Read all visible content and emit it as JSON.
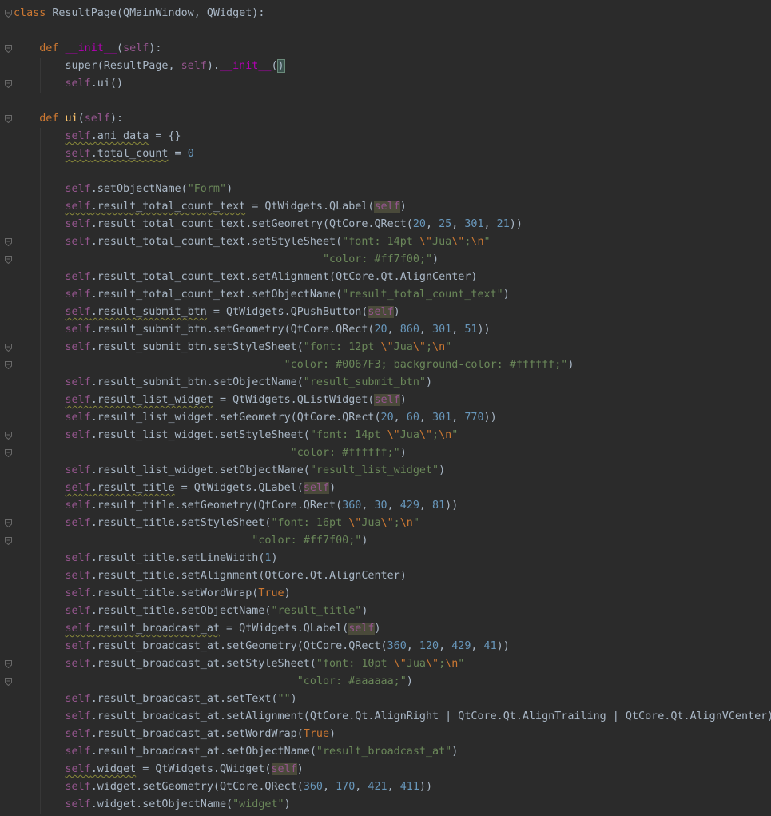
{
  "editor": {
    "language": "python",
    "colors": {
      "background": "#2b2b2b",
      "default_text": "#a9b7c6",
      "keyword": "#cc7832",
      "function_name": "#ffc66d",
      "self": "#94558d",
      "string": "#6a8759",
      "number": "#6897bb",
      "magic_method": "#b200b2"
    },
    "lines": [
      [
        {
          "t": "class",
          "c": "kw"
        },
        {
          "t": " ResultPage(QMainWindow, QWidget):"
        }
      ],
      [],
      [
        {
          "t": "    "
        },
        {
          "t": "def",
          "c": "kw"
        },
        {
          "t": " "
        },
        {
          "t": "__init__",
          "c": "magic"
        },
        {
          "t": "("
        },
        {
          "t": "self",
          "c": "self"
        },
        {
          "t": "):"
        }
      ],
      [
        {
          "t": "        super(ResultPage, "
        },
        {
          "t": "self",
          "c": "self"
        },
        {
          "t": ")."
        },
        {
          "t": "__init__",
          "c": "magic"
        },
        {
          "t": "("
        },
        {
          "t": ")",
          "c": "brk"
        }
      ],
      [
        {
          "t": "        "
        },
        {
          "t": "self",
          "c": "self"
        },
        {
          "t": ".ui()"
        }
      ],
      [],
      [
        {
          "t": "    "
        },
        {
          "t": "def",
          "c": "kw"
        },
        {
          "t": " "
        },
        {
          "t": "ui",
          "c": "fn"
        },
        {
          "t": "("
        },
        {
          "t": "self",
          "c": "self"
        },
        {
          "t": "):"
        }
      ],
      [
        {
          "t": "        "
        },
        {
          "t": "self",
          "c": "self warn"
        },
        {
          "t": ".ani_data",
          "c": "warn"
        },
        {
          "t": " = {}"
        }
      ],
      [
        {
          "t": "        "
        },
        {
          "t": "self",
          "c": "self warn"
        },
        {
          "t": ".total_count",
          "c": "warn"
        },
        {
          "t": " = "
        },
        {
          "t": "0",
          "c": "num"
        }
      ],
      [],
      [
        {
          "t": "        "
        },
        {
          "t": "self",
          "c": "self"
        },
        {
          "t": ".setObjectName("
        },
        {
          "t": "\"Form\"",
          "c": "str"
        },
        {
          "t": ")"
        }
      ],
      [
        {
          "t": "        "
        },
        {
          "t": "self",
          "c": "self warn"
        },
        {
          "t": ".result_total_count_text",
          "c": "warn"
        },
        {
          "t": " = QtWidgets.QLabel("
        },
        {
          "t": "self",
          "c": "self hl"
        },
        {
          "t": ")"
        }
      ],
      [
        {
          "t": "        "
        },
        {
          "t": "self",
          "c": "self"
        },
        {
          "t": ".result_total_count_text.setGeometry(QtCore.QRect("
        },
        {
          "t": "20",
          "c": "num"
        },
        {
          "t": ", "
        },
        {
          "t": "25",
          "c": "num"
        },
        {
          "t": ", "
        },
        {
          "t": "301",
          "c": "num"
        },
        {
          "t": ", "
        },
        {
          "t": "21",
          "c": "num"
        },
        {
          "t": "))"
        }
      ],
      [
        {
          "t": "        "
        },
        {
          "t": "self",
          "c": "self"
        },
        {
          "t": ".result_total_count_text.setStyleSheet("
        },
        {
          "t": "\"font: 14pt ",
          "c": "str"
        },
        {
          "t": "\\\"",
          "c": "esc"
        },
        {
          "t": "Jua",
          "c": "str"
        },
        {
          "t": "\\\"",
          "c": "esc"
        },
        {
          "t": ";",
          "c": "str"
        },
        {
          "t": "\\n",
          "c": "esc"
        },
        {
          "t": "\"",
          "c": "str"
        }
      ],
      [
        {
          "t": "                                                "
        },
        {
          "t": "\"color: #ff7f00;\"",
          "c": "str"
        },
        {
          "t": ")"
        }
      ],
      [
        {
          "t": "        "
        },
        {
          "t": "self",
          "c": "self"
        },
        {
          "t": ".result_total_count_text.setAlignment(QtCore.Qt.AlignCenter)"
        }
      ],
      [
        {
          "t": "        "
        },
        {
          "t": "self",
          "c": "self"
        },
        {
          "t": ".result_total_count_text.setObjectName("
        },
        {
          "t": "\"result_total_count_text\"",
          "c": "str"
        },
        {
          "t": ")"
        }
      ],
      [
        {
          "t": "        "
        },
        {
          "t": "self",
          "c": "self warn"
        },
        {
          "t": ".result_submit_btn",
          "c": "warn"
        },
        {
          "t": " = QtWidgets.QPushButton("
        },
        {
          "t": "self",
          "c": "self hl"
        },
        {
          "t": ")"
        }
      ],
      [
        {
          "t": "        "
        },
        {
          "t": "self",
          "c": "self"
        },
        {
          "t": ".result_submit_btn.setGeometry(QtCore.QRect("
        },
        {
          "t": "20",
          "c": "num"
        },
        {
          "t": ", "
        },
        {
          "t": "860",
          "c": "num"
        },
        {
          "t": ", "
        },
        {
          "t": "301",
          "c": "num"
        },
        {
          "t": ", "
        },
        {
          "t": "51",
          "c": "num"
        },
        {
          "t": "))"
        }
      ],
      [
        {
          "t": "        "
        },
        {
          "t": "self",
          "c": "self"
        },
        {
          "t": ".result_submit_btn.setStyleSheet("
        },
        {
          "t": "\"font: 12pt ",
          "c": "str"
        },
        {
          "t": "\\\"",
          "c": "esc"
        },
        {
          "t": "Jua",
          "c": "str"
        },
        {
          "t": "\\\"",
          "c": "esc"
        },
        {
          "t": ";",
          "c": "str"
        },
        {
          "t": "\\n",
          "c": "esc"
        },
        {
          "t": "\"",
          "c": "str"
        }
      ],
      [
        {
          "t": "                                          "
        },
        {
          "t": "\"color: #0067F3; background-color: #ffffff;\"",
          "c": "str"
        },
        {
          "t": ")"
        }
      ],
      [
        {
          "t": "        "
        },
        {
          "t": "self",
          "c": "self"
        },
        {
          "t": ".result_submit_btn.setObjectName("
        },
        {
          "t": "\"result_submit_btn\"",
          "c": "str"
        },
        {
          "t": ")"
        }
      ],
      [
        {
          "t": "        "
        },
        {
          "t": "self",
          "c": "self warn"
        },
        {
          "t": ".result_list_widget",
          "c": "warn"
        },
        {
          "t": " = QtWidgets.QListWidget("
        },
        {
          "t": "self",
          "c": "self hl"
        },
        {
          "t": ")"
        }
      ],
      [
        {
          "t": "        "
        },
        {
          "t": "self",
          "c": "self"
        },
        {
          "t": ".result_list_widget.setGeometry(QtCore.QRect("
        },
        {
          "t": "20",
          "c": "num"
        },
        {
          "t": ", "
        },
        {
          "t": "60",
          "c": "num"
        },
        {
          "t": ", "
        },
        {
          "t": "301",
          "c": "num"
        },
        {
          "t": ", "
        },
        {
          "t": "770",
          "c": "num"
        },
        {
          "t": "))"
        }
      ],
      [
        {
          "t": "        "
        },
        {
          "t": "self",
          "c": "self"
        },
        {
          "t": ".result_list_widget.setStyleSheet("
        },
        {
          "t": "\"font: 14pt ",
          "c": "str"
        },
        {
          "t": "\\\"",
          "c": "esc"
        },
        {
          "t": "Jua",
          "c": "str"
        },
        {
          "t": "\\\"",
          "c": "esc"
        },
        {
          "t": ";",
          "c": "str"
        },
        {
          "t": "\\n",
          "c": "esc"
        },
        {
          "t": "\"",
          "c": "str"
        }
      ],
      [
        {
          "t": "                                           "
        },
        {
          "t": "\"color: #ffffff;\"",
          "c": "str"
        },
        {
          "t": ")"
        }
      ],
      [
        {
          "t": "        "
        },
        {
          "t": "self",
          "c": "self"
        },
        {
          "t": ".result_list_widget.setObjectName("
        },
        {
          "t": "\"result_list_widget\"",
          "c": "str"
        },
        {
          "t": ")"
        }
      ],
      [
        {
          "t": "        "
        },
        {
          "t": "self",
          "c": "self warn"
        },
        {
          "t": ".result_title",
          "c": "warn"
        },
        {
          "t": " = QtWidgets.QLabel("
        },
        {
          "t": "self",
          "c": "self hl"
        },
        {
          "t": ")"
        }
      ],
      [
        {
          "t": "        "
        },
        {
          "t": "self",
          "c": "self"
        },
        {
          "t": ".result_title.setGeometry(QtCore.QRect("
        },
        {
          "t": "360",
          "c": "num"
        },
        {
          "t": ", "
        },
        {
          "t": "30",
          "c": "num"
        },
        {
          "t": ", "
        },
        {
          "t": "429",
          "c": "num"
        },
        {
          "t": ", "
        },
        {
          "t": "81",
          "c": "num"
        },
        {
          "t": "))"
        }
      ],
      [
        {
          "t": "        "
        },
        {
          "t": "self",
          "c": "self"
        },
        {
          "t": ".result_title.setStyleSheet("
        },
        {
          "t": "\"font: 16pt ",
          "c": "str"
        },
        {
          "t": "\\\"",
          "c": "esc"
        },
        {
          "t": "Jua",
          "c": "str"
        },
        {
          "t": "\\\"",
          "c": "esc"
        },
        {
          "t": ";",
          "c": "str"
        },
        {
          "t": "\\n",
          "c": "esc"
        },
        {
          "t": "\"",
          "c": "str"
        }
      ],
      [
        {
          "t": "                                     "
        },
        {
          "t": "\"color: #ff7f00;\"",
          "c": "str"
        },
        {
          "t": ")"
        }
      ],
      [
        {
          "t": "        "
        },
        {
          "t": "self",
          "c": "self"
        },
        {
          "t": ".result_title.setLineWidth("
        },
        {
          "t": "1",
          "c": "num"
        },
        {
          "t": ")"
        }
      ],
      [
        {
          "t": "        "
        },
        {
          "t": "self",
          "c": "self"
        },
        {
          "t": ".result_title.setAlignment(QtCore.Qt.AlignCenter)"
        }
      ],
      [
        {
          "t": "        "
        },
        {
          "t": "self",
          "c": "self"
        },
        {
          "t": ".result_title.setWordWrap("
        },
        {
          "t": "True",
          "c": "kw"
        },
        {
          "t": ")"
        }
      ],
      [
        {
          "t": "        "
        },
        {
          "t": "self",
          "c": "self"
        },
        {
          "t": ".result_title.setObjectName("
        },
        {
          "t": "\"result_title\"",
          "c": "str"
        },
        {
          "t": ")"
        }
      ],
      [
        {
          "t": "        "
        },
        {
          "t": "self",
          "c": "self warn"
        },
        {
          "t": ".result_broadcast_at",
          "c": "warn"
        },
        {
          "t": " = QtWidgets.QLabel("
        },
        {
          "t": "self",
          "c": "self hl"
        },
        {
          "t": ")"
        }
      ],
      [
        {
          "t": "        "
        },
        {
          "t": "self",
          "c": "self"
        },
        {
          "t": ".result_broadcast_at.setGeometry(QtCore.QRect("
        },
        {
          "t": "360",
          "c": "num"
        },
        {
          "t": ", "
        },
        {
          "t": "120",
          "c": "num"
        },
        {
          "t": ", "
        },
        {
          "t": "429",
          "c": "num"
        },
        {
          "t": ", "
        },
        {
          "t": "41",
          "c": "num"
        },
        {
          "t": "))"
        }
      ],
      [
        {
          "t": "        "
        },
        {
          "t": "self",
          "c": "self"
        },
        {
          "t": ".result_broadcast_at.setStyleSheet("
        },
        {
          "t": "\"font: 10pt ",
          "c": "str"
        },
        {
          "t": "\\\"",
          "c": "esc"
        },
        {
          "t": "Jua",
          "c": "str"
        },
        {
          "t": "\\\"",
          "c": "esc"
        },
        {
          "t": ";",
          "c": "str"
        },
        {
          "t": "\\n",
          "c": "esc"
        },
        {
          "t": "\"",
          "c": "str"
        }
      ],
      [
        {
          "t": "                                            "
        },
        {
          "t": "\"color: #aaaaaa;\"",
          "c": "str"
        },
        {
          "t": ")"
        }
      ],
      [
        {
          "t": "        "
        },
        {
          "t": "self",
          "c": "self"
        },
        {
          "t": ".result_broadcast_at.setText("
        },
        {
          "t": "\"\"",
          "c": "str"
        },
        {
          "t": ")"
        }
      ],
      [
        {
          "t": "        "
        },
        {
          "t": "self",
          "c": "self"
        },
        {
          "t": ".result_broadcast_at.setAlignment(QtCore.Qt.AlignRight | QtCore.Qt.AlignTrailing | QtCore.Qt.AlignVCenter)"
        }
      ],
      [
        {
          "t": "        "
        },
        {
          "t": "self",
          "c": "self"
        },
        {
          "t": ".result_broadcast_at.setWordWrap("
        },
        {
          "t": "True",
          "c": "kw"
        },
        {
          "t": ")"
        }
      ],
      [
        {
          "t": "        "
        },
        {
          "t": "self",
          "c": "self"
        },
        {
          "t": ".result_broadcast_at.setObjectName("
        },
        {
          "t": "\"result_broadcast_at\"",
          "c": "str"
        },
        {
          "t": ")"
        }
      ],
      [
        {
          "t": "        "
        },
        {
          "t": "self",
          "c": "self warn"
        },
        {
          "t": ".widget",
          "c": "warn"
        },
        {
          "t": " = QtWidgets.QWidget("
        },
        {
          "t": "self",
          "c": "self hl"
        },
        {
          "t": ")"
        }
      ],
      [
        {
          "t": "        "
        },
        {
          "t": "self",
          "c": "self"
        },
        {
          "t": ".widget.setGeometry(QtCore.QRect("
        },
        {
          "t": "360",
          "c": "num"
        },
        {
          "t": ", "
        },
        {
          "t": "170",
          "c": "num"
        },
        {
          "t": ", "
        },
        {
          "t": "421",
          "c": "num"
        },
        {
          "t": ", "
        },
        {
          "t": "411",
          "c": "num"
        },
        {
          "t": "))"
        }
      ],
      [
        {
          "t": "        "
        },
        {
          "t": "self",
          "c": "self"
        },
        {
          "t": ".widget.setObjectName("
        },
        {
          "t": "\"widget\"",
          "c": "str"
        },
        {
          "t": ")"
        }
      ]
    ]
  }
}
